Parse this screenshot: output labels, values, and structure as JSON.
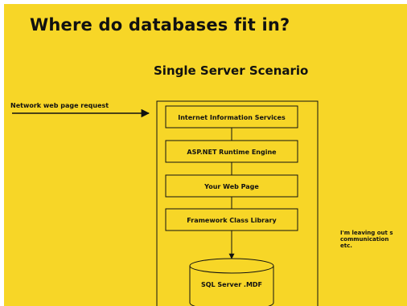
{
  "slide": {
    "title": "Where do databases fit in?",
    "subtitle": "Single Server Scenario",
    "request_label": "Network web page request",
    "side_note_lines": [
      "I'm leaving out s",
      "communication",
      "etc."
    ]
  },
  "diagram": {
    "layers": [
      "Internet Information Services",
      "ASP.NET Runtime Engine",
      "Your Web Page",
      "Framework Class Library"
    ],
    "database_label": "SQL Server .MDF"
  },
  "colors": {
    "background": "#f7d627",
    "ink": "#111111"
  }
}
